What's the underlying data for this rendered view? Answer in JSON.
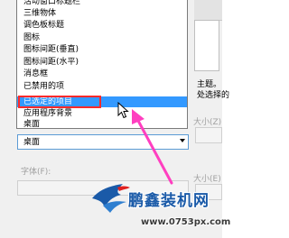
{
  "dialog": {
    "description_line_1": "主题。",
    "description_line_2": "处选择的",
    "size_label": "大小(Z)",
    "size_label_2": "大小(E)",
    "font_label": "字体(F):"
  },
  "item_list": {
    "items": [
      {
        "label": "活动窗口标题栏",
        "selected": false
      },
      {
        "label": "三维物体",
        "selected": false
      },
      {
        "label": "调色板标题",
        "selected": false
      },
      {
        "label": "图标",
        "selected": false
      },
      {
        "label": "图标间距(垂直)",
        "selected": false
      },
      {
        "label": "图标间距(水平)",
        "selected": false
      },
      {
        "label": "消息框",
        "selected": false
      },
      {
        "label": "已禁用的项",
        "selected": false
      },
      {
        "label": "已选定的项目",
        "selected": true
      },
      {
        "label": "应用程序背景",
        "selected": false
      },
      {
        "label": "桌面",
        "selected": false
      }
    ]
  },
  "combo": {
    "value": "桌面"
  },
  "watermark": {
    "title": "鹏鑫装机网",
    "url": "www.0753px.com"
  },
  "colors": {
    "selection": "#3399ff",
    "highlight_box": "#ff2a2a",
    "annotation_arrow": "#ff3fc0",
    "watermark_blue": "#1a5aa8"
  },
  "icons": {
    "combo_arrow": "chevron-down-icon",
    "cursor": "mouse-pointer-icon",
    "annotation": "arrow-icon",
    "logo": "eagle-logo-icon"
  }
}
